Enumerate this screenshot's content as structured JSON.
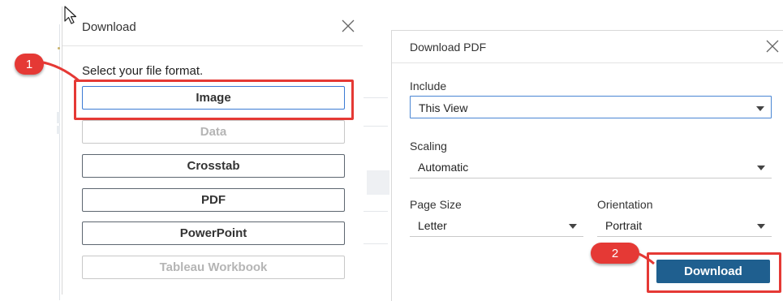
{
  "download_dialog": {
    "title": "Download",
    "prompt": "Select your file format.",
    "formats": [
      {
        "label": "Image",
        "state": "selected"
      },
      {
        "label": "Data",
        "state": "disabled"
      },
      {
        "label": "Crosstab",
        "state": "enabled"
      },
      {
        "label": "PDF",
        "state": "enabled"
      },
      {
        "label": "PowerPoint",
        "state": "enabled"
      },
      {
        "label": "Tableau Workbook",
        "state": "disabled"
      }
    ]
  },
  "pdf_dialog": {
    "title": "Download PDF",
    "include_label": "Include",
    "include_value": "This View",
    "scaling_label": "Scaling",
    "scaling_value": "Automatic",
    "page_size_label": "Page Size",
    "page_size_value": "Letter",
    "orientation_label": "Orientation",
    "orientation_value": "Portrait",
    "download_label": "Download"
  },
  "callouts": {
    "step1": "1",
    "step2": "2"
  },
  "colors": {
    "callout": "#e53935",
    "primary_button": "#1f5f8f",
    "focus": "#4a86d4"
  }
}
